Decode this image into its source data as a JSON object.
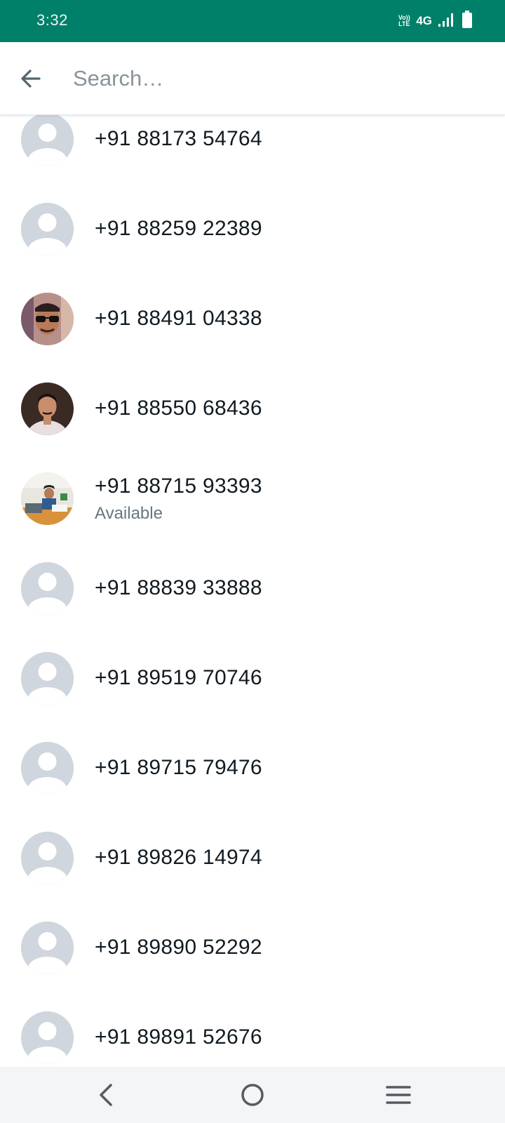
{
  "status_bar": {
    "time": "3:32",
    "volte_label": "Vo)) LTE",
    "network": "4G",
    "icons": [
      "volte-icon",
      "signal-icon",
      "battery-icon"
    ]
  },
  "search": {
    "placeholder": "Search…",
    "value": "",
    "back_icon": "arrow-left-icon"
  },
  "contacts": [
    {
      "phone": "+91 88173 54764",
      "status": "",
      "avatar": "default-avatar"
    },
    {
      "phone": "+91 88259 22389",
      "status": "",
      "avatar": "default-avatar"
    },
    {
      "phone": "+91 88491 04338",
      "status": "",
      "avatar": "photo-sunglasses"
    },
    {
      "phone": "+91 88550 68436",
      "status": "",
      "avatar": "photo-portrait"
    },
    {
      "phone": "+91 88715 93393",
      "status": "Available",
      "avatar": "photo-office"
    },
    {
      "phone": "+91 88839 33888",
      "status": "",
      "avatar": "default-avatar"
    },
    {
      "phone": "+91 89519 70746",
      "status": "",
      "avatar": "default-avatar"
    },
    {
      "phone": "+91 89715 79476",
      "status": "",
      "avatar": "default-avatar"
    },
    {
      "phone": "+91 89826 14974",
      "status": "",
      "avatar": "default-avatar"
    },
    {
      "phone": "+91 89890 52292",
      "status": "",
      "avatar": "default-avatar"
    },
    {
      "phone": "+91 89891 52676",
      "status": "",
      "avatar": "default-avatar"
    }
  ],
  "nav_bar": {
    "buttons": [
      "back-icon",
      "home-icon",
      "menu-icon"
    ]
  },
  "colors": {
    "status_bar": "#008069",
    "primary_text": "#111b21",
    "secondary_text": "#667781",
    "avatar_placeholder": "#cfd6dd"
  }
}
